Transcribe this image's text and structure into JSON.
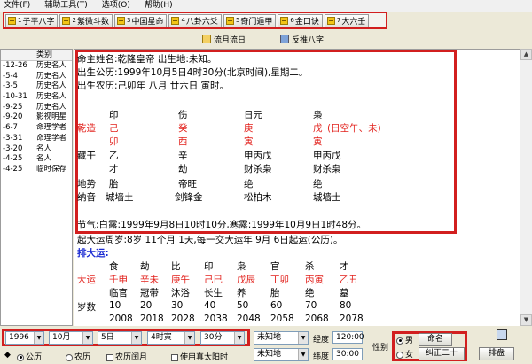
{
  "menu": [
    "文件(F)",
    "辅助工具(T)",
    "选项(O)",
    "帮助(H)"
  ],
  "tabs": [
    {
      "num": "1",
      "label": "子平八字"
    },
    {
      "num": "2",
      "label": "紫微斗数"
    },
    {
      "num": "3",
      "label": "中国星命"
    },
    {
      "num": "4",
      "label": "八卦六爻"
    },
    {
      "num": "5",
      "label": "奇门遁甲"
    },
    {
      "num": "6",
      "label": "金口诀"
    },
    {
      "num": "7",
      "label": "大六壬"
    }
  ],
  "subtools": {
    "liuyue": "流月流日",
    "fantui": "反推八字"
  },
  "left_list": {
    "header_category": "类别",
    "rows": [
      {
        "date": "-12-26",
        "cat": "历史名人"
      },
      {
        "date": "-5-4",
        "cat": "历史名人"
      },
      {
        "date": "-3-5",
        "cat": "历史名人"
      },
      {
        "date": "-10-31",
        "cat": "历史名人"
      },
      {
        "date": "-9-25",
        "cat": "历史名人"
      },
      {
        "date": "-9-20",
        "cat": "影视明星"
      },
      {
        "date": "-6-7",
        "cat": "命理学者"
      },
      {
        "date": "-3-31",
        "cat": "命理学者"
      },
      {
        "date": "-3-20",
        "cat": "名人"
      },
      {
        "date": "-4-25",
        "cat": "名人"
      },
      {
        "date": "-4-25",
        "cat": "临时保存"
      }
    ]
  },
  "chart": {
    "line1": "命主姓名:乾隆皇帝   出生地:未知。",
    "line2": "出生公历:1999年10月5日4时30分(北京时间),星期二。",
    "line3": "出生农历:己卯年  八月  廿六日  寅时。",
    "shishen": [
      "印",
      "伤",
      "日元",
      "枭"
    ],
    "qianzao_label": "乾造",
    "gan": [
      "己",
      "癸",
      "庚",
      "戊"
    ],
    "gan_note": "(日空午、未)",
    "zhi": [
      "卯",
      "酉",
      "寅",
      "寅"
    ],
    "canggan_label": "藏干",
    "canggan": [
      "乙",
      "辛",
      "甲丙戊",
      "甲丙戊"
    ],
    "canggan_ss": [
      "才",
      "劫",
      "财杀枭",
      "财杀枭"
    ],
    "dishi_label": "地势",
    "dishi": [
      "胎",
      "帝旺",
      "绝",
      "绝"
    ],
    "nayin_label": "纳音",
    "nayin": [
      "城墙土",
      "剑锋金",
      "松柏木",
      "城墙土"
    ],
    "jieqi": "节气:白露:1999年9月8日10时10分,寒露:1999年10月9日1时48分。",
    "qiyun": "起大运周岁:8岁  11个月  1天,每一交大运年  9月  6日起运(公历)。",
    "dayun_title": "排大运:",
    "dayun_ss": [
      "食",
      "劫",
      "比",
      "印",
      "枭",
      "官",
      "杀",
      "才"
    ],
    "dayun_label": "大运",
    "dayun_gz": [
      "壬申",
      "辛未",
      "庚午",
      "己巳",
      "戊辰",
      "丁卯",
      "丙寅",
      "乙丑"
    ],
    "dayun_ds": [
      "临官",
      "冠带",
      "沐浴",
      "长生",
      "养",
      "胎",
      "绝",
      "墓"
    ],
    "sui_label": "岁数",
    "sui": [
      "10",
      "20",
      "30",
      "40",
      "50",
      "60",
      "70",
      "80"
    ],
    "nian_row": [
      "2008",
      "2018",
      "2028",
      "2038",
      "2048",
      "2058",
      "2068",
      "2078"
    ]
  },
  "bottom": {
    "year": "1996",
    "month": "10月",
    "day": "5日",
    "hour": "4时寅",
    "minute": "30分",
    "place1": "未知地",
    "place2": "未知地",
    "jingdu_label": "经度",
    "jingdu": "120:00",
    "weidu_label": "纬度",
    "weidu": "30:00",
    "gongli": "公历",
    "nongli": "农历",
    "nongli_run": "农历闰月",
    "zhentaiyang": "使用真太阳时",
    "xingbie_label": "性别",
    "male": "男",
    "female": "女",
    "ming_btn": "命名",
    "jiuzheng_btn": "纠正二十",
    "paipan_btn": "排盘"
  }
}
